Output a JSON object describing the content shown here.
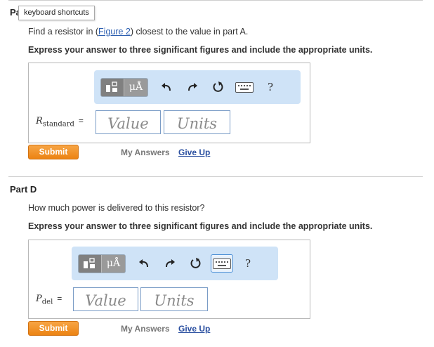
{
  "tooltip": {
    "text": "keyboard shortcuts"
  },
  "part_c": {
    "header_partial": "Pa",
    "question_pre": "Find a resistor in (",
    "figure_link": "Figure 2",
    "question_post": ") closest to the value in part A.",
    "instruction": "Express your answer to three significant figures and include the appropriate units.",
    "var_name": "R",
    "var_sub": "standard",
    "equals": "=",
    "value_placeholder": "Value",
    "units_placeholder": "Units",
    "submit_label": "Submit",
    "my_answers_label": "My Answers",
    "give_up_label": "Give Up"
  },
  "part_d": {
    "header": "Part D",
    "question": "How much power is delivered to this resistor?",
    "instruction": "Express your answer to three significant figures and include the appropriate units.",
    "var_name": "P",
    "var_sub": "del",
    "equals": "=",
    "value_placeholder": "Value",
    "units_placeholder": "Units",
    "submit_label": "Submit",
    "my_answers_label": "My Answers",
    "give_up_label": "Give Up"
  },
  "toolbar": {
    "units_glyph": "μÅ",
    "help_glyph": "?",
    "icons": [
      "templates-icon",
      "units-icon",
      "undo-icon",
      "redo-icon",
      "reset-icon",
      "keyboard-icon",
      "help-icon"
    ]
  },
  "colors": {
    "toolbar_bg": "#cfe3f7",
    "submit_orange": "#ec8313",
    "link_blue": "#2a4fa0",
    "field_border": "#7a9cc6"
  }
}
